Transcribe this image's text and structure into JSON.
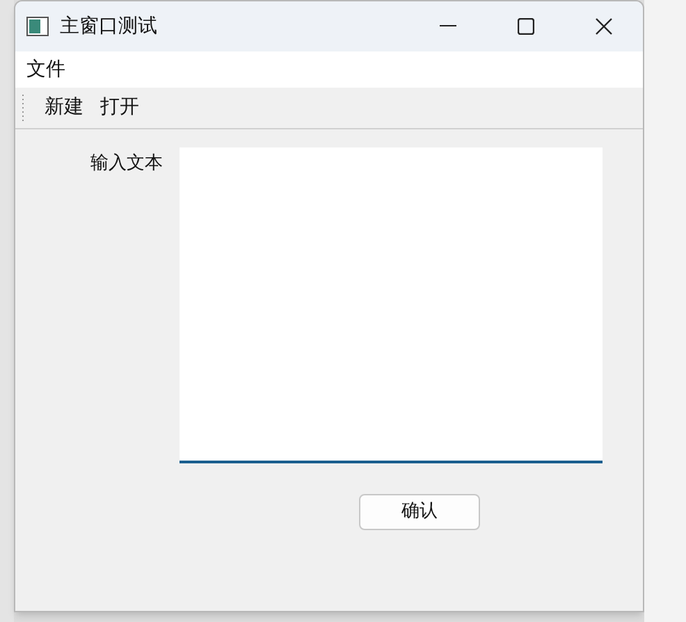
{
  "window": {
    "title": "主窗口测试"
  },
  "menu": [
    "文件"
  ],
  "toolbar": [
    "新建",
    "打开"
  ],
  "form": {
    "label": "输入文本"
  },
  "buttons": [
    "确认"
  ]
}
